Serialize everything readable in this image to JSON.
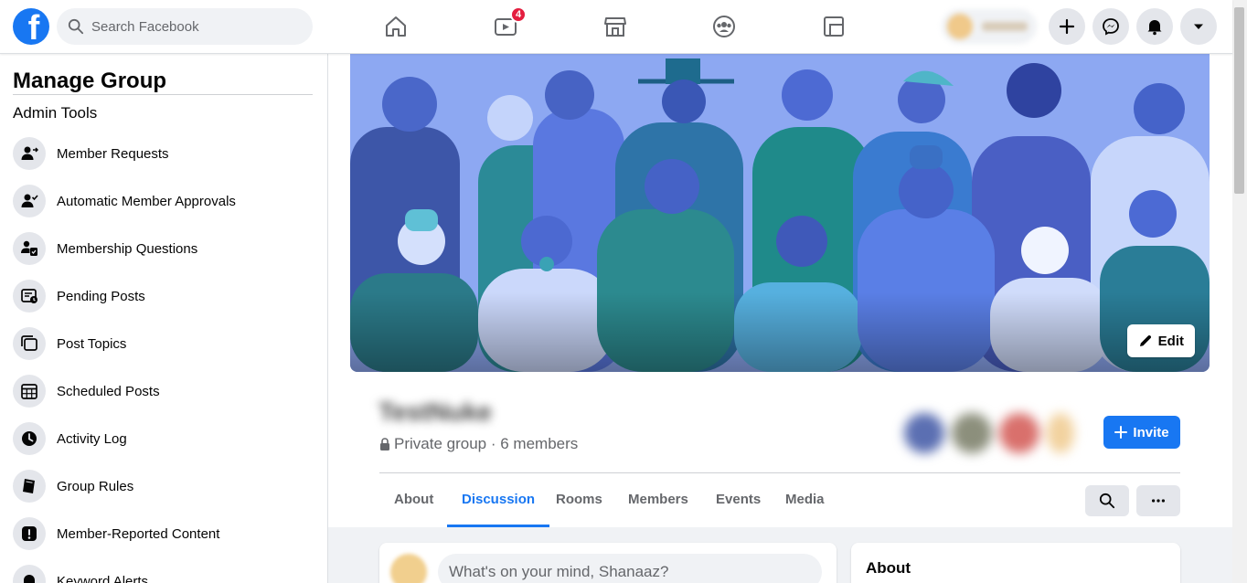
{
  "topbar": {
    "logo_letter": "f",
    "search_placeholder": "Search Facebook",
    "video_badge": "4",
    "nav_icons": [
      "home-icon",
      "watch-icon",
      "marketplace-icon",
      "groups-icon",
      "gaming-icon"
    ],
    "profile_name": "Shanaaz",
    "action_icons": [
      "plus-icon",
      "messenger-icon",
      "notifications-icon",
      "account-menu-icon"
    ]
  },
  "sidebar": {
    "title": "Manage Group",
    "subtitle": "Admin Tools",
    "items": [
      {
        "label": "Member Requests",
        "icon": "member-request-icon"
      },
      {
        "label": "Automatic Member Approvals",
        "icon": "auto-approve-icon"
      },
      {
        "label": "Membership Questions",
        "icon": "membership-questions-icon"
      },
      {
        "label": "Pending Posts",
        "icon": "pending-posts-icon"
      },
      {
        "label": "Post Topics",
        "icon": "post-topics-icon"
      },
      {
        "label": "Scheduled Posts",
        "icon": "calendar-icon"
      },
      {
        "label": "Activity Log",
        "icon": "clock-icon"
      },
      {
        "label": "Group Rules",
        "icon": "book-icon"
      },
      {
        "label": "Member-Reported Content",
        "icon": "alert-icon"
      },
      {
        "label": "Keyword Alerts",
        "icon": "bell-icon"
      }
    ]
  },
  "group": {
    "name": "TestNuke",
    "privacy": "Private group",
    "member_count": "6 members",
    "edit_label": "Edit",
    "invite_label": "Invite",
    "tabs": [
      "About",
      "Discussion",
      "Rooms",
      "Members",
      "Events",
      "Media"
    ],
    "active_tab": "Discussion"
  },
  "composer": {
    "placeholder": "What's on your mind, Shanaaz?"
  },
  "about_card": {
    "title": "About"
  },
  "colors": {
    "brand": "#1877f2",
    "badge": "#e41e3f",
    "cover_bg": "#8fa7ef"
  }
}
